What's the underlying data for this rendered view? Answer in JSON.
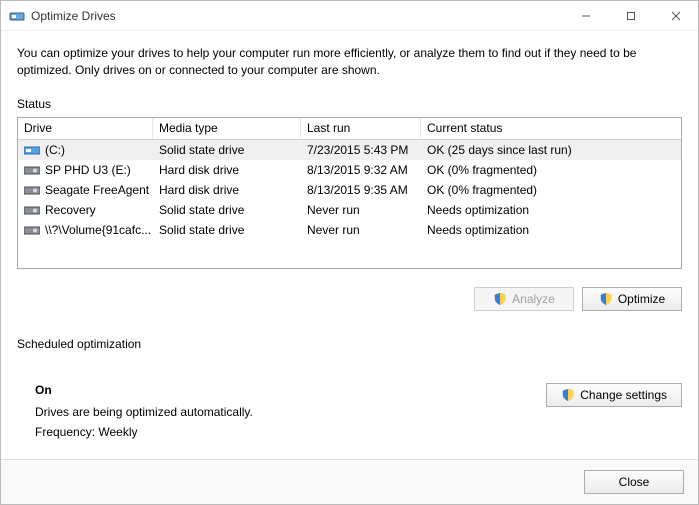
{
  "window": {
    "title": "Optimize Drives"
  },
  "intro": "You can optimize your drives to help your computer run more efficiently, or analyze them to find out if they need to be optimized. Only drives on or connected to your computer are shown.",
  "status_label": "Status",
  "columns": {
    "drive": "Drive",
    "media": "Media type",
    "lastrun": "Last run",
    "status": "Current status"
  },
  "drives": [
    {
      "icon": "ssd",
      "name": "(C:)",
      "media": "Solid state drive",
      "lastrun": "7/23/2015 5:43 PM",
      "status": "OK (25 days since last run)",
      "selected": true
    },
    {
      "icon": "hdd",
      "name": "SP PHD U3 (E:)",
      "media": "Hard disk drive",
      "lastrun": "8/13/2015 9:32 AM",
      "status": "OK (0% fragmented)"
    },
    {
      "icon": "hdd",
      "name": "Seagate FreeAgent",
      "media": "Hard disk drive",
      "lastrun": "8/13/2015 9:35 AM",
      "status": "OK (0% fragmented)"
    },
    {
      "icon": "hdd",
      "name": "Recovery",
      "media": "Solid state drive",
      "lastrun": "Never run",
      "status": "Needs optimization"
    },
    {
      "icon": "hdd",
      "name": "\\\\?\\Volume{91cafc...",
      "media": "Solid state drive",
      "lastrun": "Never run",
      "status": "Needs optimization"
    }
  ],
  "buttons": {
    "analyze": "Analyze",
    "optimize": "Optimize",
    "change_settings": "Change settings",
    "close": "Close"
  },
  "scheduled": {
    "label": "Scheduled optimization",
    "state": "On",
    "desc": "Drives are being optimized automatically.",
    "freq": "Frequency: Weekly"
  }
}
